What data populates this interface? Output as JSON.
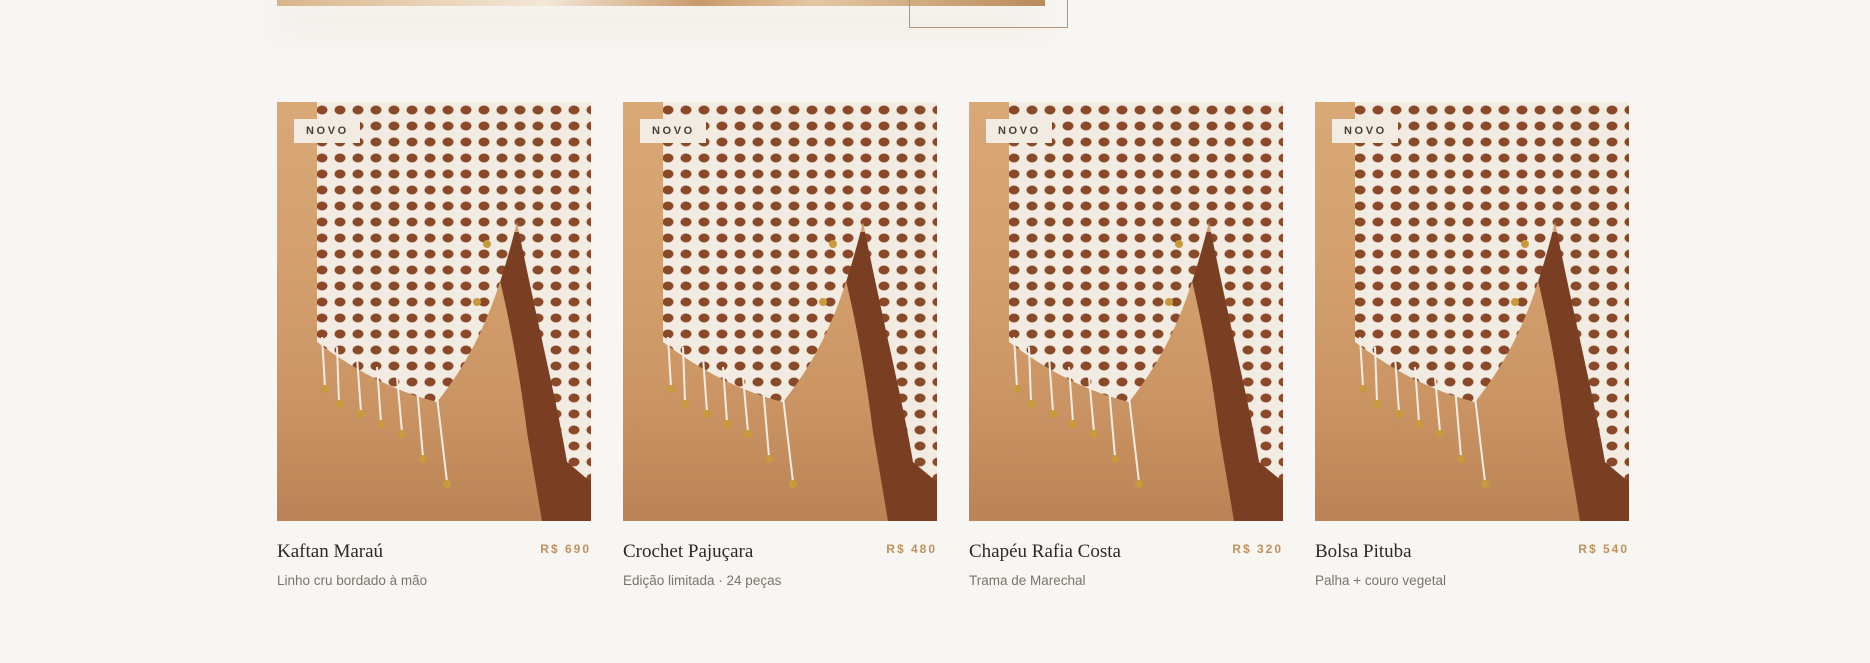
{
  "colors": {
    "background": "#f8f6f2",
    "accent_price": "#c0915f",
    "badge_bg": "#f2ebe2",
    "text_primary": "#2f2822",
    "text_secondary": "#7c736b"
  },
  "products": [
    {
      "badge": "NOVO",
      "name": "Kaftan Maraú",
      "price": "R$ 690",
      "description": "Linho cru bordado à mão",
      "image": "crochet-fringe-garment-photo"
    },
    {
      "badge": "NOVO",
      "name": "Crochet Pajuçara",
      "price": "R$ 480",
      "description": "Edição limitada · 24 peças",
      "image": "crochet-fringe-garment-photo"
    },
    {
      "badge": "NOVO",
      "name": "Chapéu Rafia Costa",
      "price": "R$ 320",
      "description": "Trama de Marechal",
      "image": "crochet-fringe-garment-photo"
    },
    {
      "badge": "NOVO",
      "name": "Bolsa Pituba",
      "price": "R$ 540",
      "description": "Palha + couro vegetal",
      "image": "crochet-fringe-garment-photo"
    }
  ]
}
